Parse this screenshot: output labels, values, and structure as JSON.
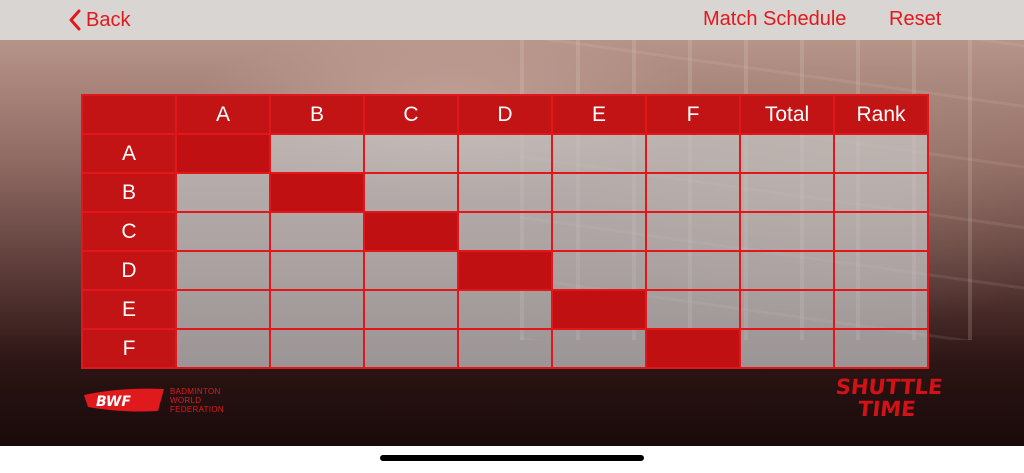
{
  "nav": {
    "back_label": "Back",
    "schedule_label": "Match Schedule",
    "reset_label": "Reset"
  },
  "grid": {
    "columns": [
      "A",
      "B",
      "C",
      "D",
      "E",
      "F",
      "Total",
      "Rank"
    ],
    "rows": [
      "A",
      "B",
      "C",
      "D",
      "E",
      "F"
    ]
  },
  "branding": {
    "bwf_logo": "BWF",
    "bwf_text": [
      "BADMINTON",
      "WORLD",
      "FEDERATION"
    ],
    "shuttle_time": [
      "SHUTTLE",
      "TIME"
    ]
  },
  "colors": {
    "accent": "#e0191d",
    "header_red": "#c21315"
  }
}
